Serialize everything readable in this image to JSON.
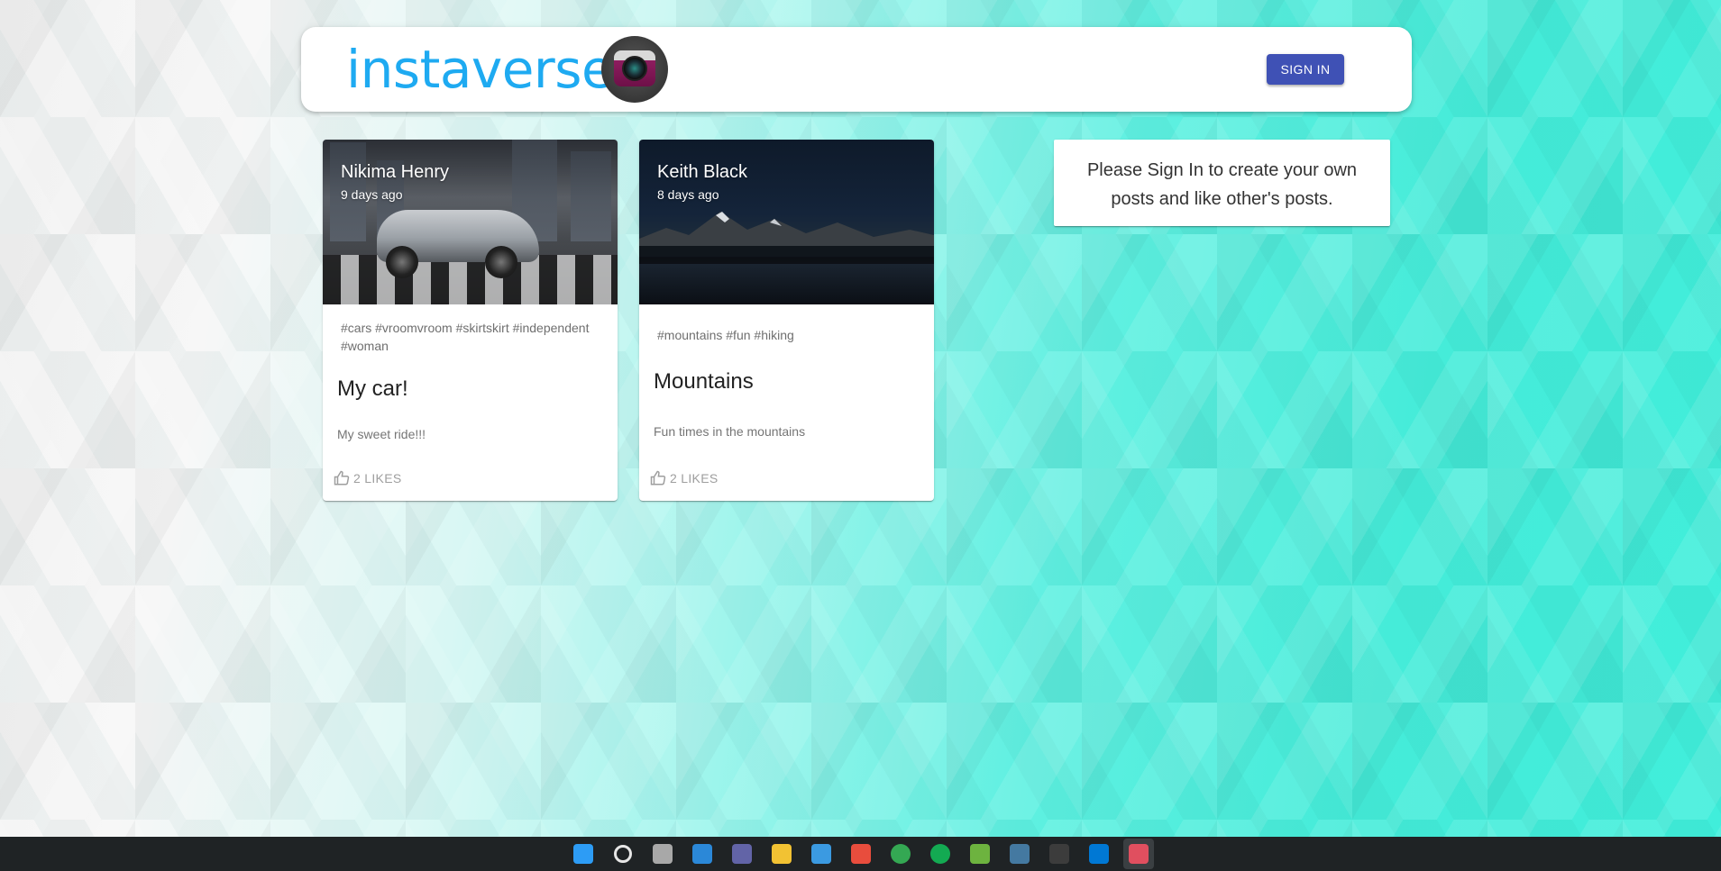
{
  "header": {
    "brand_title": "instaverse",
    "signin_label": "SIGN IN"
  },
  "posts": [
    {
      "author": "Nikima Henry",
      "time": "9 days ago",
      "tags": "#cars #vroomvroom #skirtskirt #independent #woman",
      "title": "My car!",
      "body": "My sweet ride!!!",
      "likes_label": "2 LIKES"
    },
    {
      "author": "Keith Black",
      "time": "8 days ago",
      "tags": "#mountains #fun #hiking",
      "title": "Mountains",
      "body": "Fun times in the mountains",
      "likes_label": "2 LIKES"
    }
  ],
  "notice": {
    "text": "Please Sign In to create your own posts and like other's posts."
  },
  "taskbar": {
    "items": [
      {
        "name": "windows-start-icon",
        "color": "#2d9cf5"
      },
      {
        "name": "search-icon",
        "color": "#e6e6e6"
      },
      {
        "name": "task-view-icon",
        "color": "#a8a8a8"
      },
      {
        "name": "widgets-icon",
        "color": "#2b88d8"
      },
      {
        "name": "teams-chat-icon",
        "color": "#6264a7"
      },
      {
        "name": "file-explorer-icon",
        "color": "#f2c233"
      },
      {
        "name": "microsoft-store-icon",
        "color": "#3b9ae1"
      },
      {
        "name": "sourcetree-icon",
        "color": "#e84d3d"
      },
      {
        "name": "chrome-icon",
        "color": "#34a853"
      },
      {
        "name": "mongodb-compass-icon",
        "color": "#13aa52"
      },
      {
        "name": "spring-tool-icon",
        "color": "#6db33f"
      },
      {
        "name": "mysql-workbench-icon",
        "color": "#4479a1"
      },
      {
        "name": "terminal-icon",
        "color": "#3c3c3c"
      },
      {
        "name": "vscode-icon",
        "color": "#0078d4"
      },
      {
        "name": "snipping-tool-icon",
        "color": "#e04f5f"
      }
    ]
  }
}
